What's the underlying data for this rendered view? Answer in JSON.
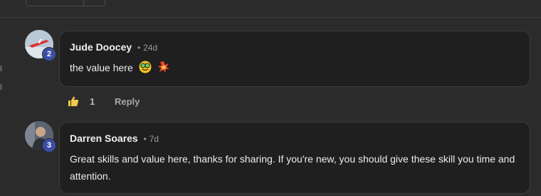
{
  "comments": [
    {
      "author": "Jude Doocey",
      "separator": "•",
      "time": "24d",
      "text": "the value here",
      "badge": "2",
      "emojis": [
        "nerd-face-emoji",
        "collision-emoji"
      ],
      "likes": "1",
      "reply_label": "Reply"
    },
    {
      "author": "Darren Soares",
      "separator": "•",
      "time": "7d",
      "text": "Great skills and value here, thanks for sharing. If you're new, you should give these skill you time and attention.",
      "badge": "3"
    }
  ],
  "colors": {
    "background": "#2b2b2b",
    "bubble": "#1f1f1f",
    "badge": "#3b4fa8"
  }
}
